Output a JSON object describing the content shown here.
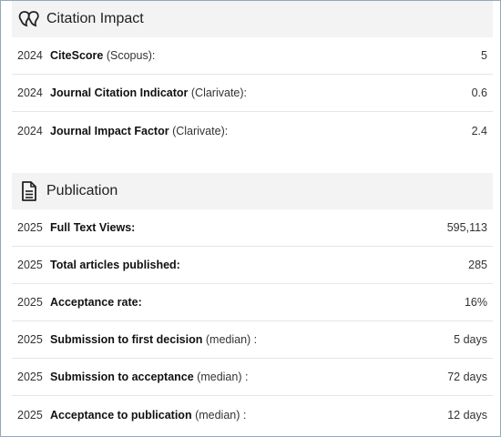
{
  "citation": {
    "title": "Citation Impact",
    "icon": "quote-bubble-icon",
    "rows": [
      {
        "year": "2024",
        "label": "CiteScore",
        "source": "(Scopus):",
        "value": "5"
      },
      {
        "year": "2024",
        "label": "Journal Citation Indicator",
        "source": "(Clarivate):",
        "value": "0.6"
      },
      {
        "year": "2024",
        "label": "Journal Impact Factor",
        "source": "(Clarivate):",
        "value": "2.4"
      }
    ]
  },
  "publication": {
    "title": "Publication",
    "icon": "document-icon",
    "rows": [
      {
        "year": "2025",
        "label": "Full Text Views:",
        "source": "",
        "value": "595,113"
      },
      {
        "year": "2025",
        "label": "Total articles published:",
        "source": "",
        "value": "285"
      },
      {
        "year": "2025",
        "label": "Acceptance rate:",
        "source": "",
        "value": "16%"
      },
      {
        "year": "2025",
        "label": "Submission to first decision",
        "source": "(median) :",
        "value": "5 days"
      },
      {
        "year": "2025",
        "label": "Submission to acceptance",
        "source": "(median) :",
        "value": "72 days"
      },
      {
        "year": "2025",
        "label": "Acceptance to publication",
        "source": "(median) :",
        "value": "12 days"
      }
    ]
  }
}
